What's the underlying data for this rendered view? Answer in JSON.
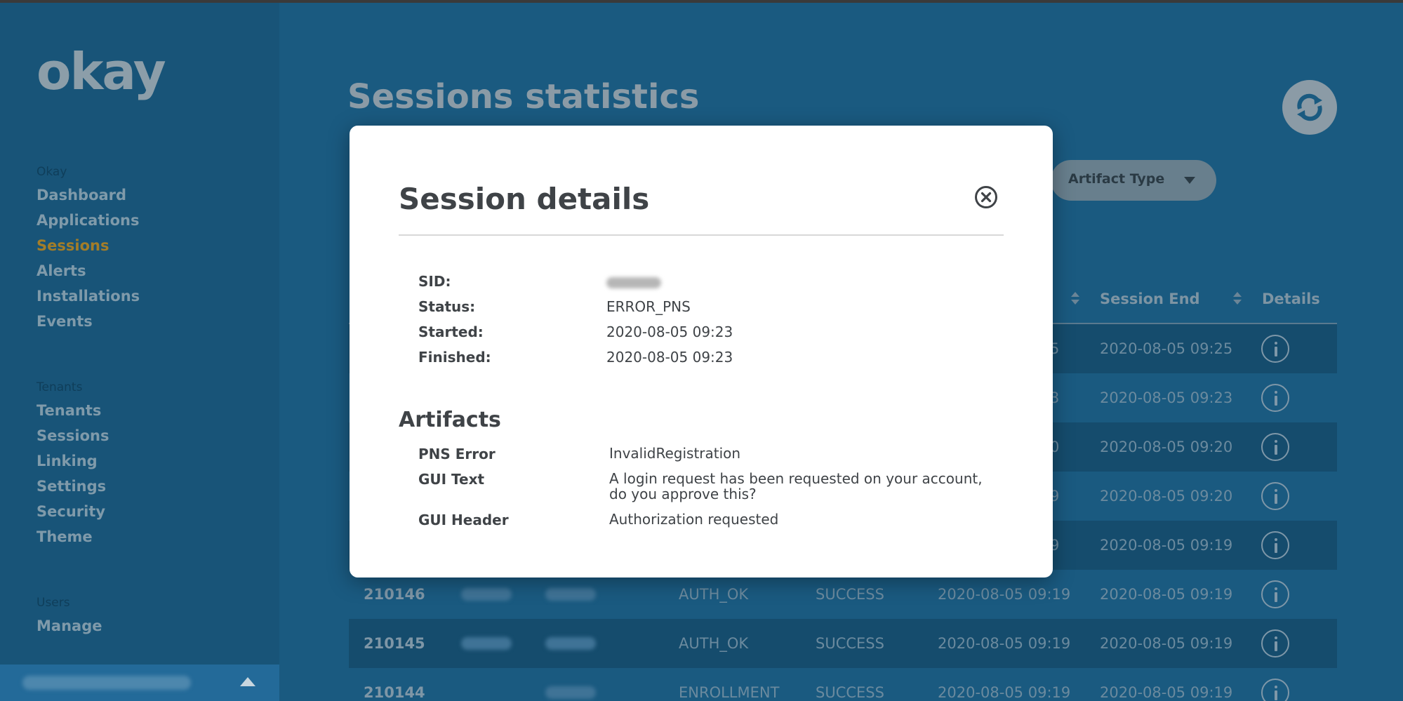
{
  "sidebar": {
    "logo": "okay",
    "groups": [
      {
        "heading": "Okay",
        "items": [
          "Dashboard",
          "Applications",
          "Sessions",
          "Alerts",
          "Installations",
          "Events"
        ]
      },
      {
        "heading": "Tenants",
        "items": [
          "Tenants",
          "Sessions",
          "Linking",
          "Settings",
          "Security",
          "Theme"
        ]
      },
      {
        "heading": "Users",
        "items": [
          "Manage"
        ]
      }
    ],
    "active_item": "Sessions"
  },
  "main": {
    "title": "Sessions statistics",
    "filter_label": "Artifact Type",
    "columns": {
      "session_end": "Session End",
      "details": "Details"
    },
    "rows": [
      {
        "partial_start": "5",
        "end": "2020-08-05 09:25"
      },
      {
        "partial_start": "3",
        "end": "2020-08-05 09:23"
      },
      {
        "partial_start": "0",
        "end": "2020-08-05 09:20"
      },
      {
        "partial_start": "9",
        "end": "2020-08-05 09:20"
      },
      {
        "partial_start": "9",
        "end": "2020-08-05 09:19"
      },
      {
        "id": "210146",
        "type": "AUTH_OK",
        "status": "SUCCESS",
        "start": "2020-08-05 09:19",
        "end": "2020-08-05 09:19"
      },
      {
        "id": "210145",
        "type": "AUTH_OK",
        "status": "SUCCESS",
        "start": "2020-08-05 09:19",
        "end": "2020-08-05 09:19"
      },
      {
        "id": "210144",
        "type": "ENROLLMENT",
        "status": "SUCCESS",
        "start": "2020-08-05 09:19",
        "end": "2020-08-05 09:19"
      }
    ]
  },
  "modal": {
    "title": "Session details",
    "fields": {
      "sid_label": "SID:",
      "status_label": "Status:",
      "status_value": "ERROR_PNS",
      "started_label": "Started:",
      "started_value": "2020-08-05 09:23",
      "finished_label": "Finished:",
      "finished_value": "2020-08-05 09:23"
    },
    "artifacts_heading": "Artifacts",
    "artifacts": [
      {
        "label": "PNS Error",
        "value": "InvalidRegistration"
      },
      {
        "label": "GUI Text",
        "value": "A login request has been requested on your account, do you approve this?"
      },
      {
        "label": "GUI Header",
        "value": "Authorization requested"
      }
    ]
  }
}
